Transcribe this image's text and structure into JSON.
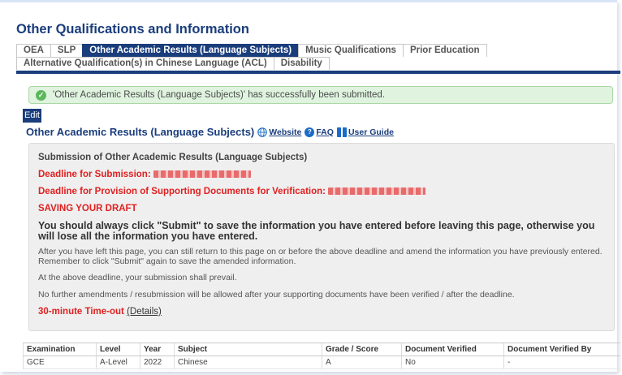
{
  "page": {
    "title": "Other Qualifications and Information"
  },
  "tabs": [
    {
      "label": "OEA",
      "active": false
    },
    {
      "label": "SLP",
      "active": false
    },
    {
      "label": "Other Academic Results (Language Subjects)",
      "active": true
    },
    {
      "label": "Music Qualifications",
      "active": false
    },
    {
      "label": "Prior Education",
      "active": false
    },
    {
      "label": "Alternative Qualification(s) in Chinese Language (ACL)",
      "active": false
    },
    {
      "label": "Disability",
      "active": false
    }
  ],
  "success_message": "'Other Academic Results (Language Subjects)' has successfully been submitted.",
  "edit_button": "Edit",
  "section": {
    "title": "Other Academic Results (Language Subjects)",
    "website_link": "Website",
    "faq_link": "FAQ",
    "guide_link": "User Guide"
  },
  "panel": {
    "subtitle": "Submission of Other Academic Results (Language Subjects)",
    "deadline_submission_label": "Deadline for Submission:",
    "deadline_documents_label": "Deadline for Provision of Supporting Documents for Verification:",
    "draft_heading": "SAVING YOUR DRAFT",
    "warning": "You should always click \"Submit\" to save the information you have entered before leaving this page, otherwise you will lose all the information you have entered.",
    "return_note": "After you have left this page, you can still return to this page on or before the above deadline and amend the information you have previously entered. Remember to click \"Submit\" again to save the amended information.",
    "prevail_note": "At the above deadline, your submission shall prevail.",
    "no_amend_note": "No further amendments / resubmission will be allowed after your supporting documents have been verified / after the deadline.",
    "timeout_label": "30-minute Time-out",
    "details_link": "(Details)"
  },
  "results": {
    "columns": [
      "Examination",
      "Level",
      "Year",
      "Subject",
      "Grade / Score",
      "Document Verified",
      "Document Verified By"
    ],
    "rows": [
      [
        "GCE",
        "A-Level",
        "2022",
        "Chinese",
        "A",
        "No",
        "-"
      ]
    ]
  },
  "colors": {
    "brand": "#1a3d7c",
    "alert": "#e02020",
    "success_bg": "#dff3de"
  },
  "icons": {
    "success": "check-circle-icon",
    "website": "globe-icon",
    "faq": "faq-icon",
    "guide": "book-icon"
  }
}
